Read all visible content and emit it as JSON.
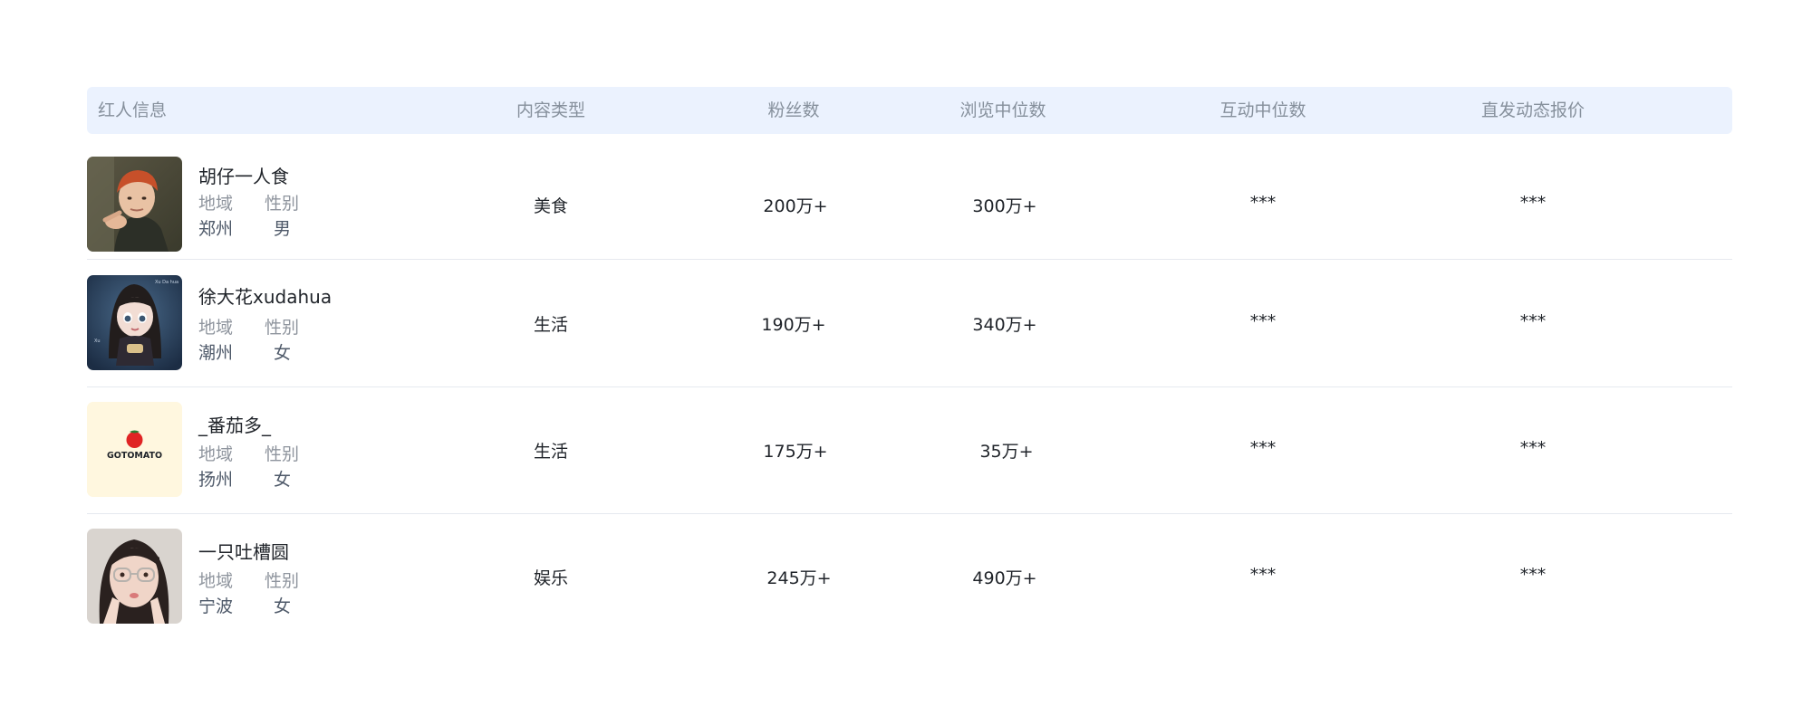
{
  "columns": {
    "info": "红人信息",
    "content_type": "内容类型",
    "fans": "粉丝数",
    "views_median": "浏览中位数",
    "interaction_median": "互动中位数",
    "price": "直发动态报价"
  },
  "labels": {
    "region": "地域",
    "gender": "性别"
  },
  "rows": [
    {
      "name": "胡仔一人食",
      "region": "郑州",
      "gender": "男",
      "content_type": "美食",
      "fans": "200万+",
      "views_median": "300万+",
      "interaction_median": "***",
      "price": "***",
      "avatar": "ginger-boy-photo"
    },
    {
      "name": "徐大花xudahua",
      "region": "潮州",
      "gender": "女",
      "content_type": "生活",
      "fans": "190万+",
      "views_median": "340万+",
      "interaction_median": "***",
      "price": "***",
      "avatar": "cartoon-girl-illustration"
    },
    {
      "name": "_番茄多_",
      "region": "扬州",
      "gender": "女",
      "content_type": "生活",
      "fans": "175万+",
      "views_median": "35万+",
      "interaction_median": "***",
      "price": "***",
      "avatar": "gotomato-logo",
      "avatar_text": "GOTOMATO"
    },
    {
      "name": "一只吐槽圆",
      "region": "宁波",
      "gender": "女",
      "content_type": "娱乐",
      "fans": "245万+",
      "views_median": "490万+",
      "interaction_median": "***",
      "price": "***",
      "avatar": "girl-with-glasses-photo"
    }
  ],
  "colors": {
    "header_bg": "#ebf2fe",
    "header_text": "#86909c",
    "row_divider": "#e6e9ef",
    "logo_bg": "#fff7df",
    "tomato_red": "#e02424"
  }
}
